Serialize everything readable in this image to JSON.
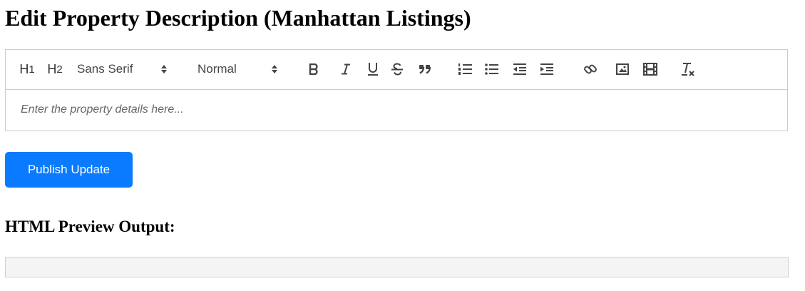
{
  "page": {
    "title": "Edit Property Description (Manhattan Listings)"
  },
  "toolbar": {
    "h1_label": "H",
    "h1_sub": "1",
    "h2_label": "H",
    "h2_sub": "2",
    "font_picker": "Sans Serif",
    "size_picker": "Normal",
    "icons": [
      "bold-icon",
      "italic-icon",
      "underline-icon",
      "strikethrough-icon",
      "blockquote-icon",
      "ordered-list-icon",
      "bullet-list-icon",
      "outdent-icon",
      "indent-icon",
      "link-icon",
      "image-icon",
      "video-icon",
      "clear-format-icon"
    ]
  },
  "editor": {
    "placeholder": "Enter the property details here..."
  },
  "actions": {
    "publish_label": "Publish Update"
  },
  "preview": {
    "heading": "HTML Preview Output:",
    "content": ""
  },
  "colors": {
    "primary": "#0a7bff",
    "border": "#cccccc",
    "icon": "#444444"
  }
}
